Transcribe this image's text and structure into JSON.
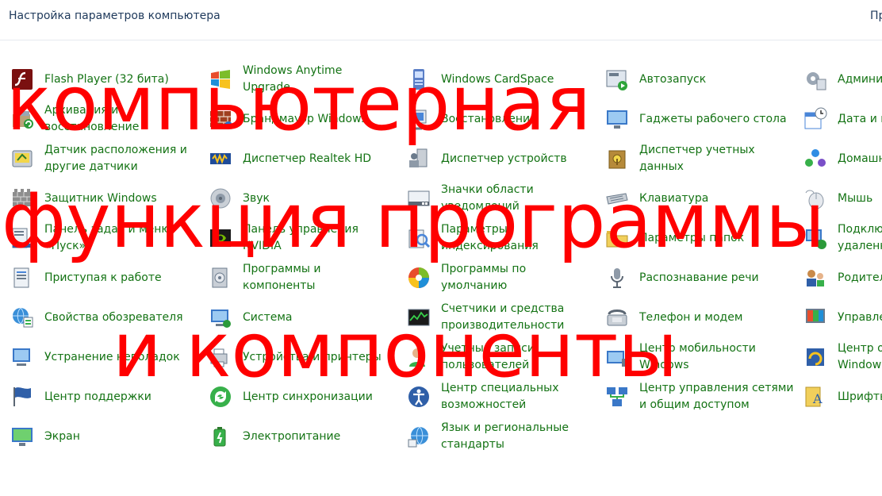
{
  "header": {
    "title": "Настройка параметров компьютера",
    "right_text": "Пр"
  },
  "items": [
    {
      "label": "Flash Player (32 бита)",
      "icon": "flash-player-icon"
    },
    {
      "label": "Windows Anytime\nUpgrade",
      "icon": "windows-flag-icon"
    },
    {
      "label": "Windows CardSpace",
      "icon": "cardspace-icon"
    },
    {
      "label": "Автозапуск",
      "icon": "autoplay-icon"
    },
    {
      "label": "Админи",
      "icon": "admin-tools-icon"
    },
    {
      "label": "Архивация и\nвосстановление",
      "icon": "backup-icon"
    },
    {
      "label": "Брандмауэр Windows",
      "icon": "firewall-icon"
    },
    {
      "label": "Восстановление",
      "icon": "recovery-icon"
    },
    {
      "label": "Гаджеты рабочего стола",
      "icon": "gadgets-icon"
    },
    {
      "label": "Дата и в",
      "icon": "date-time-icon"
    },
    {
      "label": "Датчик расположения и\nдругие датчики",
      "icon": "location-sensor-icon"
    },
    {
      "label": "Диспетчер Realtek HD",
      "icon": "realtek-icon"
    },
    {
      "label": "Диспетчер устройств",
      "icon": "device-manager-icon"
    },
    {
      "label": "Диспетчер учетных\nданных",
      "icon": "credential-manager-icon"
    },
    {
      "label": "Домашн",
      "icon": "homegroup-icon"
    },
    {
      "label": "Защитник Windows",
      "icon": "defender-icon"
    },
    {
      "label": "Звук",
      "icon": "sound-icon"
    },
    {
      "label": "Значки области\nуведомлений",
      "icon": "notification-icons-icon"
    },
    {
      "label": "Клавиатура",
      "icon": "keyboard-icon"
    },
    {
      "label": "Мышь",
      "icon": "mouse-icon"
    },
    {
      "label": "Панель задач и меню\n«Пуск»",
      "icon": "taskbar-icon"
    },
    {
      "label": "Панель управления\nNVIDIA",
      "icon": "nvidia-icon"
    },
    {
      "label": "Параметры\nиндексирования",
      "icon": "indexing-icon"
    },
    {
      "label": "Параметры папок",
      "icon": "folder-options-icon"
    },
    {
      "label": "Подклю\nудаленн",
      "icon": "remote-connection-icon"
    },
    {
      "label": "Приступая к работе",
      "icon": "getting-started-icon"
    },
    {
      "label": "Программы и\nкомпоненты",
      "icon": "programs-icon"
    },
    {
      "label": "Программы по\nумолчанию",
      "icon": "default-programs-icon"
    },
    {
      "label": "Распознавание речи",
      "icon": "microphone-icon"
    },
    {
      "label": "Родител",
      "icon": "parental-controls-icon"
    },
    {
      "label": "Свойства обозревателя",
      "icon": "internet-options-icon"
    },
    {
      "label": "Система",
      "icon": "system-icon"
    },
    {
      "label": "Счетчики и средства\nпроизводительности",
      "icon": "performance-icon"
    },
    {
      "label": "Телефон и модем",
      "icon": "phone-modem-icon"
    },
    {
      "label": "Управле",
      "icon": "color-management-icon"
    },
    {
      "label": "Устранение неполадок",
      "icon": "troubleshooting-icon"
    },
    {
      "label": "Устройства и принтеры",
      "icon": "devices-printers-icon"
    },
    {
      "label": "Учетные записи\nпользователей",
      "icon": "user-accounts-icon"
    },
    {
      "label": "Центр мобильности\nWindows",
      "icon": "mobility-center-icon"
    },
    {
      "label": "Центр о\nWindow",
      "icon": "update-center-icon"
    },
    {
      "label": "Центр поддержки",
      "icon": "action-center-icon"
    },
    {
      "label": "Центр синхронизации",
      "icon": "sync-center-icon"
    },
    {
      "label": "Центр специальных\nвозможностей",
      "icon": "ease-of-access-icon"
    },
    {
      "label": "Центр управления сетями\nи общим доступом",
      "icon": "network-center-icon"
    },
    {
      "label": "Шрифты",
      "icon": "fonts-icon"
    },
    {
      "label": "Экран",
      "icon": "display-icon"
    },
    {
      "label": "Электропитание",
      "icon": "power-options-icon"
    },
    {
      "label": "Язык и региональные\nстандарты",
      "icon": "region-language-icon"
    }
  ],
  "overlay": {
    "line1": "компьютерная",
    "line2": "функция программы",
    "line3": "и компоненты",
    "color": "#ff0000"
  },
  "colors": {
    "link": "#147314",
    "title": "#1e395b"
  }
}
